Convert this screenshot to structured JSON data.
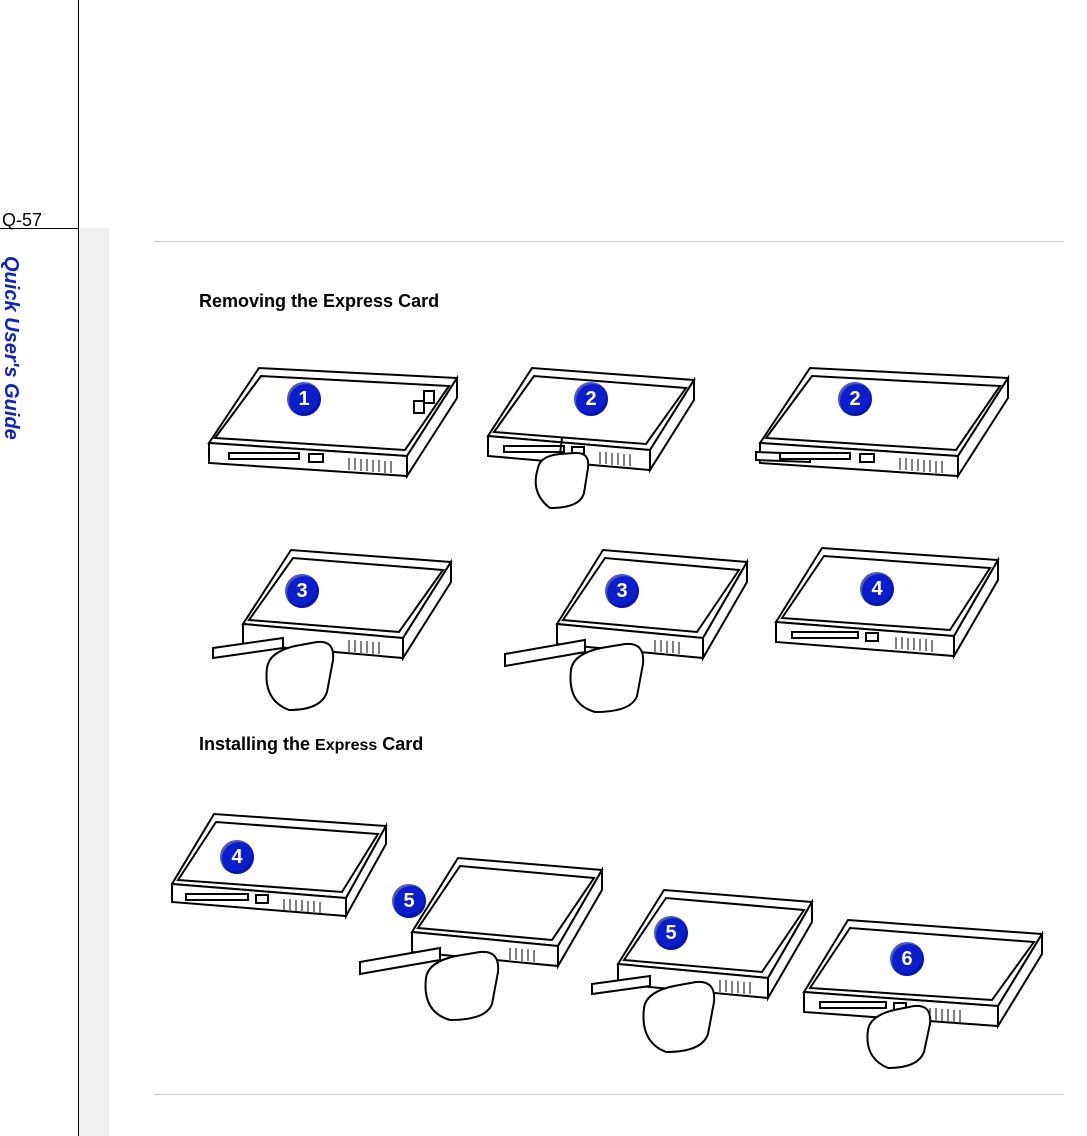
{
  "page_number": "Q-57",
  "sidebar_title": "Quick User's Guide",
  "headings": {
    "removing": "Removing the Express Card",
    "installing_prefix": "Installing the ",
    "installing_mid": "Express",
    "installing_suffix": " Card"
  },
  "badges": {
    "r1": "1",
    "r2a": "2",
    "r2b": "2",
    "r3a": "3",
    "r3b": "3",
    "r4": "4",
    "i4": "4",
    "i5a": "5",
    "i5b": "5",
    "i6": "6"
  }
}
